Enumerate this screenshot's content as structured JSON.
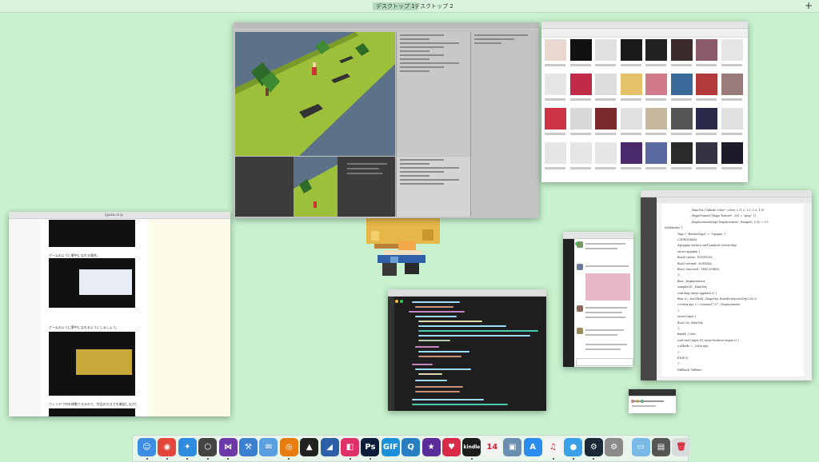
{
  "spaces": {
    "items": [
      {
        "label": "デスクトップ 1",
        "active": true
      },
      {
        "label": "デスクトップ 2",
        "active": false
      }
    ],
    "add_label": "+"
  },
  "safari": {
    "url": "jigsaw.co.jp",
    "captions": [
      "ゲームのように夢中になれる場合。",
      "ゲームのように夢中になれるようにしましょう。",
      "ウィンドウ内を移動できるので、作品の大きさを確認しながら作業できます。"
    ]
  },
  "itunes": {
    "albums": [
      {
        "color": "#e8d8d0"
      },
      {
        "color": "#111111"
      },
      {
        "color": "#e0e0e0"
      },
      {
        "color": "#1a1a1a"
      },
      {
        "color": "#222222"
      },
      {
        "color": "#3a2a2a"
      },
      {
        "color": "#8a5a6a"
      },
      {
        "color": "#e6e6e6"
      },
      {
        "color": "#e6e6e6"
      },
      {
        "color": "#c22a4a"
      },
      {
        "color": "#dcdcdc"
      },
      {
        "color": "#e4c26a"
      },
      {
        "color": "#d07a8a"
      },
      {
        "color": "#3a6a9a"
      },
      {
        "color": "#b23a3a"
      },
      {
        "color": "#9a7a7a"
      },
      {
        "color": "#cc3344"
      },
      {
        "color": "#d8d8d8"
      },
      {
        "color": "#7a2a2a"
      },
      {
        "color": "#e0e0e0"
      },
      {
        "color": "#c8b8a0"
      },
      {
        "color": "#555555"
      },
      {
        "color": "#2a2a4a"
      },
      {
        "color": "#e0e0e0"
      },
      {
        "color": "#e6e6e6"
      },
      {
        "color": "#e6e6e6"
      },
      {
        "color": "#e6e6e6"
      },
      {
        "color": "#4a2a6a"
      },
      {
        "color": "#5a6aa0"
      },
      {
        "color": "#2a2a2a"
      },
      {
        "color": "#333344"
      },
      {
        "color": "#1a1a2a"
      }
    ]
  },
  "doc": {
    "lines": [
      "_MainTex (\"Albedo Color\", color) = (1.0, 1.0, 1.0, 1.0)",
      "_ShapeFrame(\"Shape Texture\", 2D) = \"gray\" {}",
      "_DisplacementMap(\"Displacement\", Range(0, 0.3)) = 0.1",
      "SubShader {",
      "Tags { \"RenderType\" = \"Opaque\" }",
      "CGPROGRAM",
      "#pragma surface surf Lambert vertex:disp",
      "struct appdata {",
      "float4 vertex : POSITION;",
      "float3 normal : NORMAL;",
      "float2 texcoord : TEXCOORD0;",
      "};",
      "float _Displacement;",
      "sampler2D _MainTex;",
      "void disp (inout appdata v) {",
      "float d = tex2Dlod(_ShapeTex, float4(v.texcoord.xy,0,0)).r;",
      "v.vertex.xyz += v.normal * d * _Displacement;",
      "}",
      "struct Input {",
      "float2 uv_MainTex;",
      "};",
      "fixed4 _Color;",
      "void surf (Input IN, inout SurfaceOutput o) {",
      "o.Albedo = _Color.rgb;",
      "}",
      "ENDCG",
      "}",
      "FallBack \"Diffuse\""
    ]
  },
  "dock": {
    "apps": [
      {
        "name": "finder-icon",
        "glyph": "☺",
        "color": "#3d8de3",
        "running": true
      },
      {
        "name": "chrome-icon",
        "glyph": "◉",
        "color": "#e3453b",
        "running": true
      },
      {
        "name": "safari-icon",
        "glyph": "✦",
        "color": "#2f8be0",
        "running": true
      },
      {
        "name": "unity-icon",
        "glyph": "⬡",
        "color": "#444444",
        "running": true
      },
      {
        "name": "visual-studio-icon",
        "glyph": "⋈",
        "color": "#6c3aa8",
        "running": true
      },
      {
        "name": "xcode-icon",
        "glyph": "⚒",
        "color": "#3b7fd0",
        "running": false
      },
      {
        "name": "mail-icon",
        "glyph": "✉",
        "color": "#5aa0e0",
        "running": false
      },
      {
        "name": "blender-icon",
        "glyph": "◎",
        "color": "#e87d0d",
        "running": true
      },
      {
        "name": "inkscape-icon",
        "glyph": "▲",
        "color": "#222222",
        "running": false
      },
      {
        "name": "affinity-icon",
        "glyph": "◢",
        "color": "#2d5fa8",
        "running": false
      },
      {
        "name": "inspector-icon",
        "glyph": "◧",
        "color": "#e0306a",
        "running": true
      },
      {
        "name": "photoshop-icon",
        "glyph": "Ps",
        "color": "#0b1d3a",
        "running": true
      },
      {
        "name": "gif-icon",
        "glyph": "GIF",
        "color": "#1c90d8",
        "running": false
      },
      {
        "name": "quicktime-icon",
        "glyph": "Q",
        "color": "#2a7fc2",
        "running": false
      },
      {
        "name": "imovie-icon",
        "glyph": "★",
        "color": "#5b2d9a",
        "running": false
      },
      {
        "name": "lips-icon",
        "glyph": "♥",
        "color": "#d92a4a",
        "running": false
      },
      {
        "name": "kindle-icon",
        "glyph": "kindle",
        "color": "#1d1d1d",
        "running": true
      },
      {
        "name": "calendar-icon",
        "glyph": "14",
        "color": "#f4f4f4",
        "running": false
      },
      {
        "name": "preview-icon",
        "glyph": "▣",
        "color": "#6a8fb0",
        "running": false
      },
      {
        "name": "app-store-icon",
        "glyph": "A",
        "color": "#2b8cf0",
        "running": false
      },
      {
        "name": "music-icon",
        "glyph": "♫",
        "color": "#f4f4f4",
        "running": true
      },
      {
        "name": "tweetbot-icon",
        "glyph": "●",
        "color": "#3aa0e8",
        "running": true
      },
      {
        "name": "steam-icon",
        "glyph": "⚙",
        "color": "#1b2838",
        "running": true
      },
      {
        "name": "system-prefs-icon",
        "glyph": "⚙",
        "color": "#8a8a8a",
        "running": false
      },
      {
        "name": "downloads-folder-icon",
        "glyph": "▭",
        "color": "#7ab8e8",
        "running": false
      },
      {
        "name": "documents-stack-icon",
        "glyph": "▤",
        "color": "#555555",
        "running": false
      },
      {
        "name": "trash-icon",
        "glyph": "🗑",
        "color": "#d8dcdc",
        "running": false
      }
    ]
  }
}
